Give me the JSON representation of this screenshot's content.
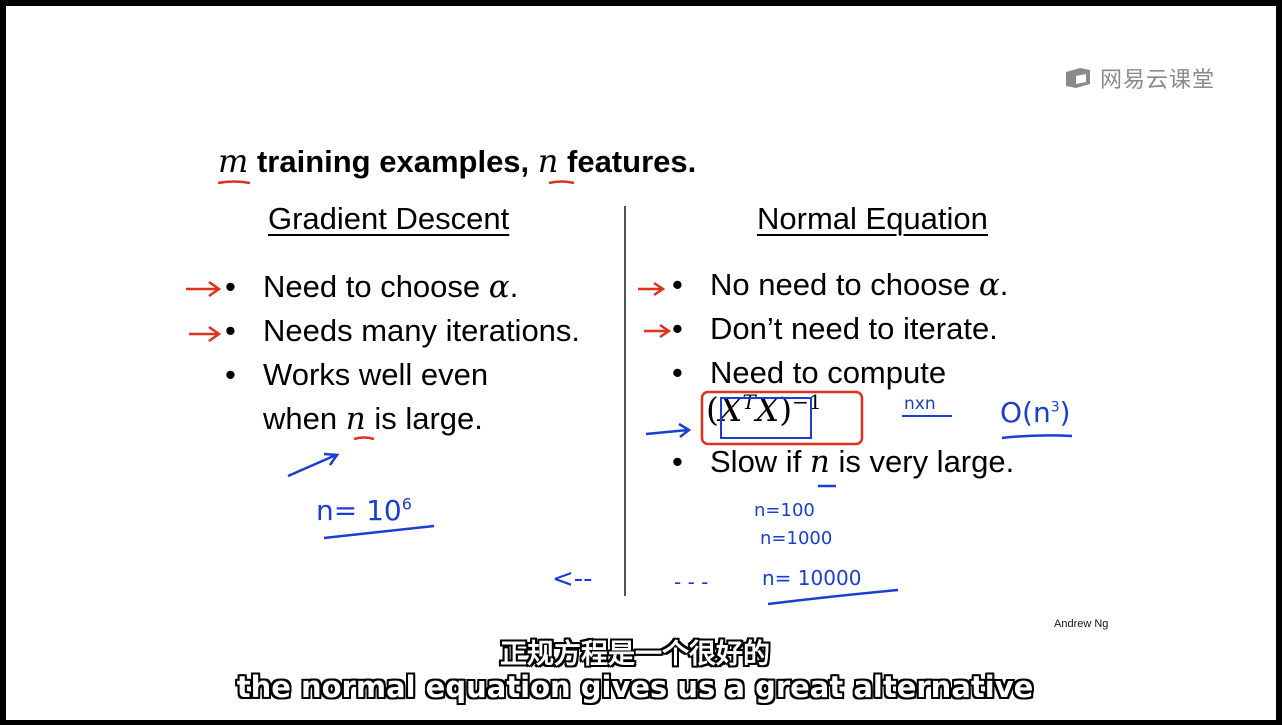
{
  "watermark": {
    "brand": "网易云课堂"
  },
  "slide": {
    "headline": {
      "m": "m",
      "part1": " training examples, ",
      "n": "n",
      "part2": " features."
    },
    "gradient_descent": {
      "title": "Gradient Descent",
      "bullets": {
        "b1_text": "Need to choose ",
        "b1_math": "α",
        "b1_end": ".",
        "b2_text": "Needs many iterations.",
        "b3_line1": "Works well even",
        "b3_line2_pre": "when ",
        "b3_line2_math": "n",
        "b3_line2_post": " is large."
      }
    },
    "normal_equation": {
      "title": "Normal Equation",
      "bullets": {
        "b1_text": "No need to choose ",
        "b1_math": "α",
        "b1_end": ".",
        "b2_text": "Don’t need to iterate.",
        "b3_text": "Need to compute",
        "formula_open": "(",
        "formula_x1": "X",
        "formula_t": "T",
        "formula_x2": "X",
        "formula_close": ")",
        "formula_exp": "−1",
        "b4_pre": "Slow if ",
        "b4_math": "n",
        "b4_post": " is very large."
      }
    },
    "bullet_symbol": "•",
    "author": "Andrew Ng"
  },
  "annotations": {
    "n_gd": "n= 10",
    "n_gd_exp": "6",
    "nxn": "nxn",
    "big_o": "O(n",
    "big_o_exp": "3",
    "big_o_close": ")",
    "n100": "n=100",
    "n1000": "n=1000",
    "n10000": "n= 10000",
    "arrow_left": "<--",
    "dashes": "- - -",
    "colors": {
      "red": "#e0301e",
      "blue": "#1a3fd0"
    }
  },
  "subtitles": {
    "chinese": "正规方程是一个很好的",
    "english": "the normal equation gives us a great alternative"
  }
}
